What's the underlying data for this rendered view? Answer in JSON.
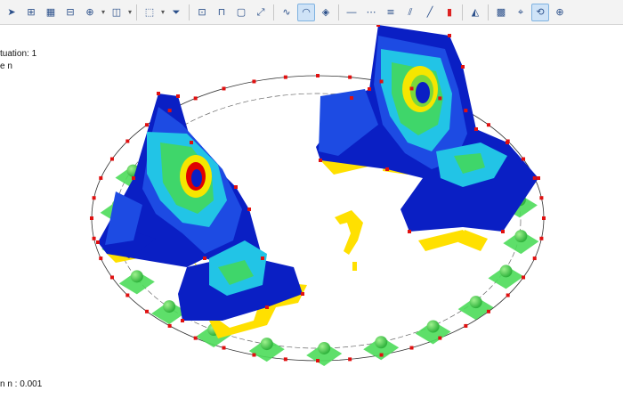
{
  "overlay": {
    "situation": "tuation: 1",
    "unit": "e n",
    "scale": "n n : 0.001"
  },
  "toolbar": {
    "icons": [
      "select-arrow-icon",
      "beam-icon",
      "grid-dimension-icon",
      "member-icon",
      "node-icon",
      "section-icon",
      "sep",
      "view-icon",
      "filter-icon",
      "sep",
      "result-diagram-icon",
      "frame-icon",
      "opening-icon",
      "fit-icon",
      "sep",
      "deformation-icon",
      "surface-result-icon",
      "solid-result-icon",
      "sep",
      "line-1-icon",
      "line-2-icon",
      "line-3-icon",
      "line-4-icon",
      "line-5-icon",
      "color-scale-icon",
      "sep",
      "render-icon",
      "sep",
      "mesh-icon",
      "snap-icon",
      "rotate-icon",
      "zoom-icon"
    ],
    "active": [
      "surface-result-icon",
      "rotate-icon"
    ],
    "accent": "#2a4f8a"
  },
  "colors": {
    "fem_blue": "#0a1fc4",
    "fem_cyan": "#22c4e6",
    "fem_green": "#3fd66a",
    "fem_yellow": "#f5e600",
    "fem_red": "#e00000",
    "support_green": "#4cdc5a",
    "support_ball": "#2fb33c",
    "warning_yellow": "#ffe000",
    "node_red": "#e01010"
  }
}
